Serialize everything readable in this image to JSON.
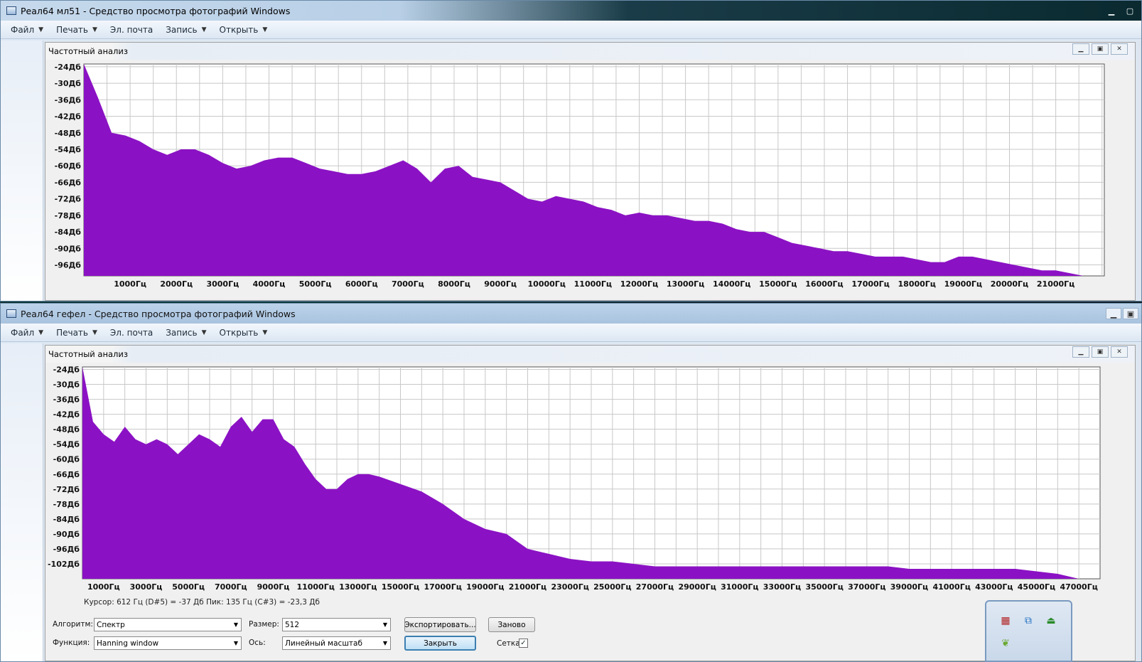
{
  "top_window": {
    "title": "Реал64 мл51 - Средство просмотра фотографий Windows",
    "menu": [
      {
        "label": "Файл",
        "has_caret": true
      },
      {
        "label": "Печать",
        "has_caret": true
      },
      {
        "label": "Эл. почта",
        "has_caret": false
      },
      {
        "label": "Запись",
        "has_caret": true
      },
      {
        "label": "Открыть",
        "has_caret": true
      }
    ],
    "panel_title": "Частотный анализ"
  },
  "bottom_window": {
    "title": "Реал64 гефел - Средство просмотра фотографий Windows",
    "menu": [
      {
        "label": "Файл",
        "has_caret": true
      },
      {
        "label": "Печать",
        "has_caret": true
      },
      {
        "label": "Эл. почта",
        "has_caret": false
      },
      {
        "label": "Запись",
        "has_caret": true
      },
      {
        "label": "Открыть",
        "has_caret": true
      }
    ],
    "panel_title": "Частотный анализ",
    "status": "Курсор: 612 Гц (D#5) = -37 Дб    Пик: 135 Гц (C#3) = -23,3 Дб",
    "controls": {
      "algorithm_label": "Алгоритм:",
      "algorithm_value": "Спектр",
      "size_label": "Размер:",
      "size_value": "512",
      "function_label": "Функция:",
      "function_value": "Hanning window",
      "axis_label": "Ось:",
      "axis_value": "Линейный масштаб",
      "export_button": "Экспортировать...",
      "replot_button": "Заново",
      "close_button": "Закрыть",
      "grid_label": "Сетка",
      "grid_checked": true
    }
  },
  "colors": {
    "fill": "#8b12c4",
    "grid": "#c8c8c8"
  },
  "chart_data": [
    {
      "type": "area",
      "y_ticks": [
        "-24Дб",
        "-30Дб",
        "-36Дб",
        "-42Дб",
        "-48Дб",
        "-54Дб",
        "-60Дб",
        "-66Дб",
        "-72Дб",
        "-78Дб",
        "-84Дб",
        "-90Дб",
        "-96Дб"
      ],
      "x_ticks": [
        "1000Гц",
        "2000Гц",
        "3000Гц",
        "4000Гц",
        "5000Гц",
        "6000Гц",
        "7000Гц",
        "8000Гц",
        "9000Гц",
        "10000Гц",
        "11000Гц",
        "12000Гц",
        "13000Гц",
        "14000Гц",
        "15000Гц",
        "16000Гц",
        "17000Гц",
        "18000Гц",
        "19000Гц",
        "20000Гц",
        "21000Гц"
      ],
      "xlim": [
        0,
        22050
      ],
      "ylim": [
        -100,
        -23
      ],
      "grid": true,
      "x": [
        0,
        300,
        600,
        900,
        1200,
        1500,
        1800,
        2100,
        2400,
        2700,
        3000,
        3300,
        3600,
        3900,
        4200,
        4500,
        4800,
        5100,
        5400,
        5700,
        6000,
        6300,
        6600,
        6900,
        7200,
        7500,
        7800,
        8100,
        8400,
        8700,
        9000,
        9300,
        9600,
        9900,
        10200,
        10500,
        10800,
        11100,
        11400,
        11700,
        12000,
        12300,
        12600,
        12900,
        13200,
        13500,
        13800,
        14100,
        14400,
        14700,
        15000,
        15300,
        15600,
        15900,
        16200,
        16500,
        16800,
        17100,
        17400,
        17700,
        18000,
        18300,
        18600,
        18900,
        19200,
        19500,
        19800,
        20100,
        20400,
        20700,
        21000,
        21300,
        21600,
        21900
      ],
      "y": [
        -23,
        -35,
        -48,
        -49,
        -51,
        -54,
        -56,
        -54,
        -54,
        -56,
        -59,
        -61,
        -60,
        -58,
        -57,
        -57,
        -59,
        -61,
        -62,
        -63,
        -63,
        -62,
        -60,
        -58,
        -61,
        -66,
        -61,
        -60,
        -64,
        -65,
        -66,
        -69,
        -72,
        -73,
        -71,
        -72,
        -73,
        -75,
        -76,
        -78,
        -77,
        -78,
        -78,
        -79,
        -80,
        -80,
        -81,
        -83,
        -84,
        -84,
        -86,
        -88,
        -89,
        -90,
        -91,
        -91,
        -92,
        -93,
        -93,
        -93,
        -94,
        -95,
        -95,
        -93,
        -93,
        -94,
        -95,
        -96,
        -97,
        -98,
        -98,
        -99,
        -100,
        -100
      ]
    },
    {
      "type": "area",
      "y_ticks": [
        "-24Дб",
        "-30Дб",
        "-36Дб",
        "-42Дб",
        "-48Дб",
        "-54Дб",
        "-60Дб",
        "-66Дб",
        "-72Дб",
        "-78Дб",
        "-84Дб",
        "-90Дб",
        "-96Дб",
        "-102Дб"
      ],
      "x_ticks": [
        "1000Гц",
        "3000Гц",
        "5000Гц",
        "7000Гц",
        "9000Гц",
        "11000Гц",
        "13000Гц",
        "15000Гц",
        "17000Гц",
        "19000Гц",
        "21000Гц",
        "23000Гц",
        "25000Гц",
        "27000Гц",
        "29000Гц",
        "31000Гц",
        "33000Гц",
        "35000Гц",
        "37000Гц",
        "39000Гц",
        "41000Гц",
        "43000Гц",
        "45000Гц",
        "47000Гц"
      ],
      "xlim": [
        0,
        48000
      ],
      "ylim": [
        -108,
        -23
      ],
      "grid": true,
      "x": [
        0,
        500,
        1000,
        1500,
        2000,
        2500,
        3000,
        3500,
        4000,
        4500,
        5000,
        5500,
        6000,
        6500,
        7000,
        7500,
        8000,
        8500,
        9000,
        9500,
        10000,
        10500,
        11000,
        11500,
        12000,
        12500,
        13000,
        13500,
        14000,
        15000,
        16000,
        17000,
        18000,
        19000,
        20000,
        21000,
        22000,
        23000,
        24000,
        25000,
        26000,
        27000,
        28000,
        29000,
        30000,
        31000,
        32000,
        33000,
        34000,
        35000,
        36000,
        37000,
        38000,
        39000,
        40000,
        41000,
        42000,
        43000,
        44000,
        45000,
        46000,
        47000
      ],
      "y": [
        -23,
        -45,
        -50,
        -53,
        -47,
        -52,
        -54,
        -52,
        -54,
        -58,
        -54,
        -50,
        -52,
        -55,
        -47,
        -43,
        -49,
        -44,
        -44,
        -52,
        -55,
        -62,
        -68,
        -72,
        -72,
        -68,
        -66,
        -66,
        -67,
        -70,
        -73,
        -78,
        -84,
        -88,
        -90,
        -96,
        -98,
        -100,
        -101,
        -101,
        -102,
        -103,
        -103,
        -103,
        -103,
        -103,
        -103,
        -103,
        -103,
        -103,
        -103,
        -103,
        -103,
        -104,
        -104,
        -104,
        -104,
        -104,
        -104,
        -105,
        -106,
        -108
      ]
    }
  ],
  "tray_icons": [
    "table-icon",
    "network-icon",
    "usb-safe-remove-icon",
    "leaf-icon"
  ]
}
